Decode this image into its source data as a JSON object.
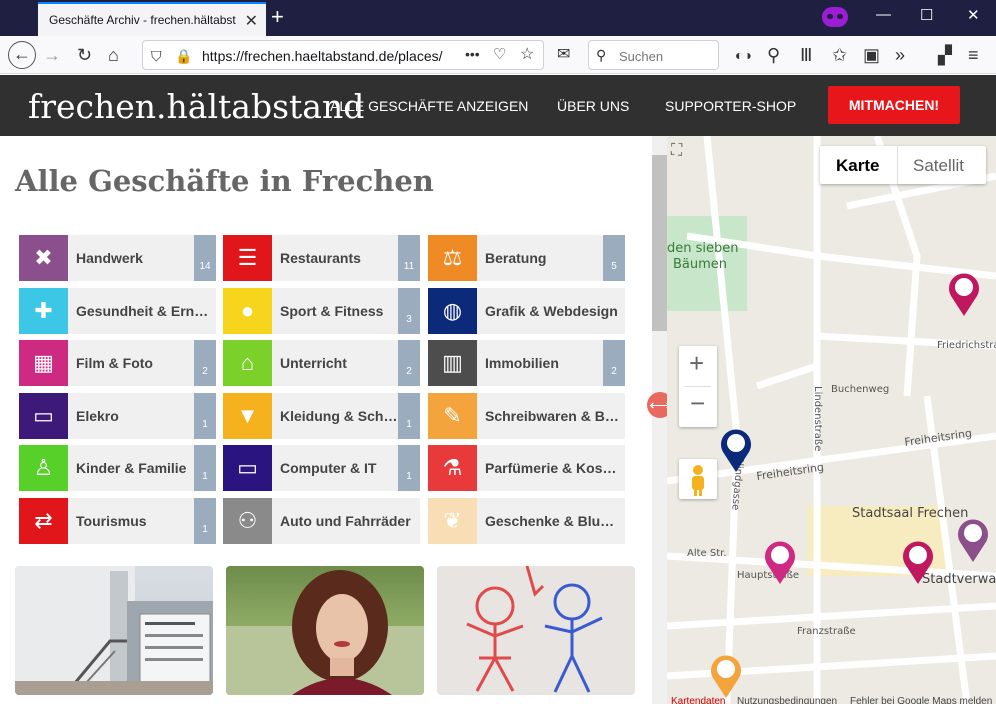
{
  "browser": {
    "tab_title": "Geschäfte Archiv - frechen.hältabst",
    "url": "https://frechen.haeltabstand.de/places/",
    "search_placeholder": "Suchen"
  },
  "site": {
    "logo": "frechen.hältabstand",
    "nav": [
      "ALLE GESCHÄFTE ANZEIGEN",
      "ÜBER UNS",
      "SUPPORTER-SHOP"
    ],
    "cta": "MITMACHEN!"
  },
  "page_title": "Alle Geschäfte in Frechen",
  "categories": [
    {
      "label": "Handwerk",
      "count": "14",
      "color": "#8b4f8c",
      "icon": "tools-icon"
    },
    {
      "label": "Restaurants",
      "count": "11",
      "color": "#e0161b",
      "icon": "burger-icon"
    },
    {
      "label": "Beratung",
      "count": "5",
      "color": "#f08a25",
      "icon": "scales-icon"
    },
    {
      "label": "Gesundheit & Ernäh...",
      "count": "",
      "color": "#3cc7e6",
      "icon": "ambulance-icon"
    },
    {
      "label": "Sport & Fitness",
      "count": "3",
      "color": "#f7d51d",
      "icon": "ball-icon"
    },
    {
      "label": "Grafik & Webdesign",
      "count": "",
      "color": "#0b2a7a",
      "icon": "globe-icon"
    },
    {
      "label": "Film & Foto",
      "count": "2",
      "color": "#cf2a82",
      "icon": "film-icon"
    },
    {
      "label": "Unterricht",
      "count": "2",
      "color": "#7bd12a",
      "icon": "building-icon"
    },
    {
      "label": "Immobilien",
      "count": "2",
      "color": "#4d4d4d",
      "icon": "office-icon"
    },
    {
      "label": "Elekro",
      "count": "1",
      "color": "#3d1a7a",
      "icon": "monitor-icon"
    },
    {
      "label": "Kleidung & Schuhe",
      "count": "1",
      "color": "#f5b21e",
      "icon": "shirt-icon"
    },
    {
      "label": "Schreibwaren & Büro",
      "count": "",
      "color": "#f4a43c",
      "icon": "pencil-icon"
    },
    {
      "label": "Kinder & Familie",
      "count": "1",
      "color": "#57d02a",
      "icon": "child-icon"
    },
    {
      "label": "Computer & IT",
      "count": "1",
      "color": "#2a1580",
      "icon": "monitor-icon"
    },
    {
      "label": "Parfümerie & Kosme...",
      "count": "",
      "color": "#e8393b",
      "icon": "flask-icon"
    },
    {
      "label": "Tourismus",
      "count": "1",
      "color": "#e0161b",
      "icon": "signpost-icon"
    },
    {
      "label": "Auto und Fahrräder",
      "count": "",
      "color": "#8a8a8a",
      "icon": "bicycle-icon"
    },
    {
      "label": "Geschenke & Blumen",
      "count": "",
      "color": "#f8ddb5",
      "icon": "leaf-icon"
    }
  ],
  "map": {
    "tab_karte": "Karte",
    "tab_satellit": "Satellit",
    "labels": [
      "den sieben",
      "Bäumen",
      "Stadtsaal Frechen",
      "Stadtverwalt",
      "Lindenstraße",
      "Freiheitsring",
      "Franzstraße",
      "Blindgasse",
      "Hauptstraße",
      "Buchenweg",
      "Friedrichstraße",
      "Alte Str."
    ],
    "footer": [
      "Kartendaten",
      "Nutzungsbedingungen",
      "Fehler bei Google Maps melden"
    ]
  }
}
